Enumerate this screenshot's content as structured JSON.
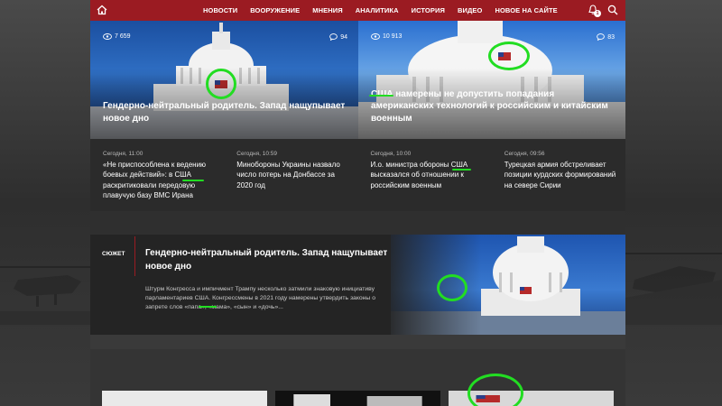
{
  "nav": {
    "items": [
      "НОВОСТИ",
      "ВООРУЖЕНИЕ",
      "МНЕНИЯ",
      "АНАЛИТИКА",
      "ИСТОРИЯ",
      "ВИДЕО",
      "НОВОЕ НА САЙТЕ"
    ],
    "notification_count": "1"
  },
  "heroes": [
    {
      "views": "7 659",
      "comments": "94",
      "title": "Гендерно-нейтральный родитель. Запад нащупывает новое дно"
    },
    {
      "views": "10 913",
      "comments": "83",
      "title": "США намерены не допустить попадания американских технологий к российским и китайским военным"
    }
  ],
  "news": [
    {
      "time": "Сегодня, 11:00",
      "text": "«Не приспособлена к ведению боевых действий»: в США раскритиковали передовую плавучую базу ВМС Ирана"
    },
    {
      "time": "Сегодня, 10:59",
      "text": "Минобороны Украины назвало число потерь на Донбассе за 2020 год"
    },
    {
      "time": "Сегодня, 10:00",
      "text": "И.о. министра обороны США высказался об отношении к российским военным"
    },
    {
      "time": "Сегодня, 09:56",
      "text": "Турецкая армия обстреливает позиции курдских формирований на севере Сирии"
    }
  ],
  "story": {
    "tag": "СЮЖЕТ",
    "title": "Гендерно-нейтральный родитель. Запад нащупывает новое дно",
    "description": "Штурм Конгресса и импичмент Трампу несколько затмили знаковую инициативу парламентариев США. Конгрессмены в 2021 году намерены утвердить законы о запрете слов «папа», «мама», «сын» и «дочь»..."
  },
  "colors": {
    "nav_bg": "#9b1b22",
    "highlight": "#22dd22"
  }
}
